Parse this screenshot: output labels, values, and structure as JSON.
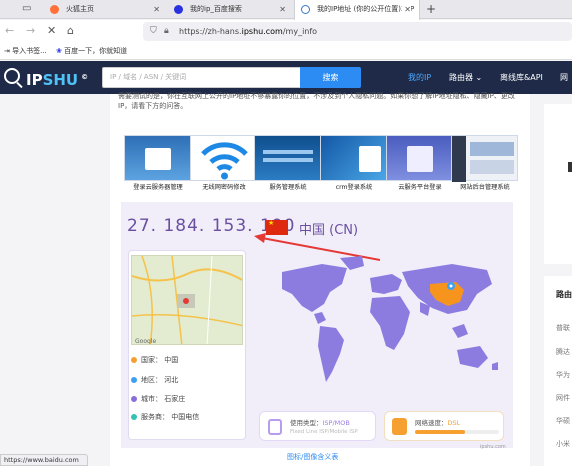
{
  "browser": {
    "tabs": [
      {
        "label": "火狐主页",
        "active": false
      },
      {
        "label": "我的ip_百度搜索",
        "active": false
      },
      {
        "label": "我的IP地址 (你的公开位置)本IP",
        "active": true
      }
    ],
    "url": {
      "prefix": "https://zh-hans.",
      "domain": "ipshu.com",
      "path": "/my_info"
    },
    "bookmarks": [
      "导入书签...",
      "百度一下，你就知道"
    ],
    "status_url": "https://www.baidu.com"
  },
  "header": {
    "logo_ip": "IP",
    "logo_shu": "SHU",
    "logo_mark": "©",
    "search_placeholder": "IP / 域名 / ASN / 关键词",
    "search_button": "搜索",
    "nav": [
      "我的IP",
      "路由器",
      "离线库&API",
      "网"
    ]
  },
  "intro": "需要测试的是，你在互联网上公开的IP地址不够暴露你的位置，不涉及到个人隐私问题。如果你想了解IP地址隐私、隐藏IP、更改IP，请看下方的问答。",
  "thumbs": [
    "登录云服务器管理",
    "无线网密码修改",
    "服务管理系统",
    "crm登录系统",
    "云服务平台登录",
    "网站后台管理系统"
  ],
  "ip": {
    "address": "27. 184. 153. 190",
    "country": "中国 (CN)",
    "flag_color": "#de2910"
  },
  "details": {
    "country": "国家：  中国",
    "region": "地区：  河北",
    "city": "城市：  石家庄",
    "isp": "服务商：  中国电信"
  },
  "type_card": {
    "label": "使用类型：",
    "value": "ISP/MOB",
    "sub": "Fixed Line ISP/Mobile ISP"
  },
  "speed_card": {
    "label": "网络速度：",
    "value": "DSL",
    "level": 0.6
  },
  "watermark": "ipshu.com",
  "legend_link": "图标/图像含义表",
  "sidebar": {
    "heading": "路由",
    "items": [
      "普联",
      "腾达",
      "华为",
      "网件",
      "华硕",
      "小米"
    ]
  },
  "colors": {
    "accent": "#2c8cf4",
    "header_bg": "#1e2a47",
    "ip_text": "#6a4fa0",
    "highlight": "#f7941d"
  }
}
